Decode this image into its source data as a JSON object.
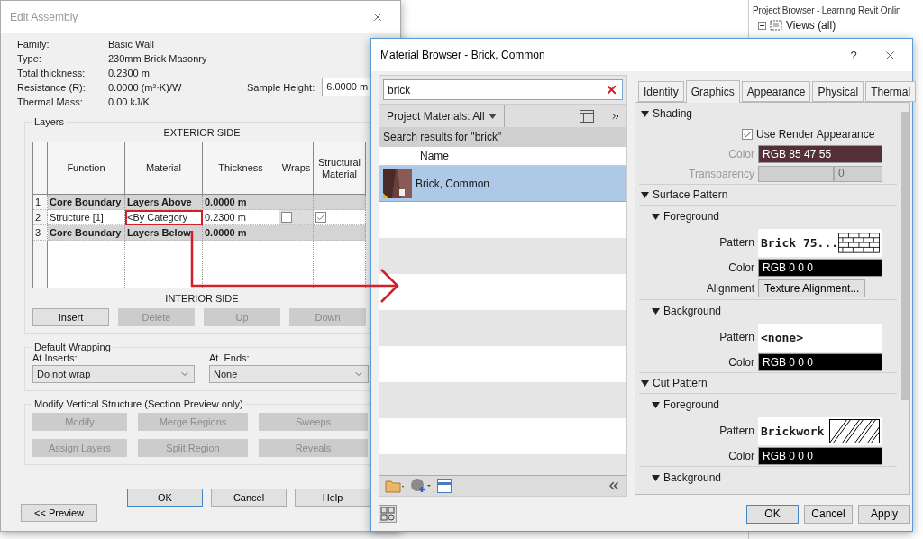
{
  "project_browser": {
    "title": "Project Browser - Learning Revit Onlin",
    "tree": [
      {
        "label": "Views (all)",
        "expanded": true
      }
    ]
  },
  "edit_assembly": {
    "title": "Edit Assembly",
    "properties": [
      {
        "label": "Family:",
        "value": "Basic Wall"
      },
      {
        "label": "Type:",
        "value": "230mm Brick Masonry"
      },
      {
        "label": "Total thickness:",
        "value": "0.2300 m"
      },
      {
        "label": "Resistance (R):",
        "value": "0.0000 (m²·K)/W"
      },
      {
        "label": "Thermal Mass:",
        "value": "0.00 kJ/K"
      }
    ],
    "sample_height": {
      "label": "Sample Height:",
      "value": "6.0000 m"
    },
    "layers": {
      "title": "Layers",
      "top_caption": "EXTERIOR SIDE",
      "bottom_caption": "INTERIOR SIDE",
      "columns": [
        "Function",
        "Material",
        "Thickness",
        "Wraps",
        "Structural Material"
      ],
      "rows": [
        {
          "index": "1",
          "kind": "boundary",
          "function": "Core Boundary",
          "material": "Layers Above",
          "thickness": "0.0000 m",
          "highlighted": false
        },
        {
          "index": "2",
          "kind": "layer",
          "function": "Structure [1]",
          "material": "<By Category",
          "thickness": "0.2300 m",
          "wraps": false,
          "structural": true,
          "highlighted": true
        },
        {
          "index": "3",
          "kind": "boundary",
          "function": "Core Boundary",
          "material": "Layers Below",
          "thickness": "0.0000 m",
          "highlighted": false
        }
      ],
      "buttons": [
        {
          "label": "Insert",
          "disabled": false
        },
        {
          "label": "Delete",
          "disabled": true
        },
        {
          "label": "Up",
          "disabled": true
        },
        {
          "label": "Down",
          "disabled": true
        }
      ]
    },
    "default_wrapping": {
      "title": "Default Wrapping",
      "fields": [
        {
          "label": "At Inserts:",
          "value": "Do not wrap"
        },
        {
          "label": "At  Ends:",
          "value": "None"
        }
      ]
    },
    "modify_structure": {
      "title": "Modify Vertical Structure (Section Preview only)",
      "buttons": [
        {
          "label": "Modify",
          "disabled": true
        },
        {
          "label": "Merge Regions",
          "disabled": true
        },
        {
          "label": "Sweeps",
          "disabled": true
        },
        {
          "label": "Assign Layers",
          "disabled": true
        },
        {
          "label": "Split Region",
          "disabled": true
        },
        {
          "label": "Reveals",
          "disabled": true
        }
      ]
    },
    "footer_buttons": [
      {
        "label": "OK",
        "default": true
      },
      {
        "label": "Cancel",
        "default": false
      },
      {
        "label": "Help",
        "default": false
      }
    ],
    "preview_button": "<< Preview"
  },
  "material_browser": {
    "title": "Material Browser - Brick, Common",
    "help": "?",
    "search": {
      "value": "brick"
    },
    "filter": "Project Materials: All",
    "results_caption": "Search results for \"brick\"",
    "list_header": "Name",
    "materials": [
      {
        "name": "Brick, Common",
        "selected": true
      }
    ],
    "tabs": [
      {
        "label": "Identity",
        "selected": false
      },
      {
        "label": "Graphics",
        "selected": true
      },
      {
        "label": "Appearance",
        "selected": false
      },
      {
        "label": "Physical",
        "selected": false
      },
      {
        "label": "Thermal",
        "selected": false
      }
    ],
    "sections": [
      {
        "title": "Shading",
        "expanded": true,
        "rows": [
          {
            "kind": "checkbox",
            "label": "Use Render Appearance",
            "checked": true
          },
          {
            "kind": "color",
            "label": "Color",
            "value": "RGB 85 47 55",
            "color": "#552f37",
            "disabled": true
          },
          {
            "kind": "transparency",
            "label": "Transparency",
            "value": "0",
            "level": 0,
            "disabled": true
          }
        ]
      },
      {
        "title": "Surface Pattern",
        "expanded": true,
        "groups": [
          {
            "title": "Foreground",
            "expanded": true,
            "rows": [
              {
                "kind": "brick_pattern",
                "label": "Pattern",
                "value": "Brick 75..."
              },
              {
                "kind": "color",
                "label": "Color",
                "value": "RGB 0 0 0",
                "color": "#000000",
                "disabled": false
              },
              {
                "kind": "button",
                "label": "Alignment",
                "value": "Texture Alignment..."
              }
            ]
          },
          {
            "title": "Background",
            "expanded": true,
            "rows": [
              {
                "kind": "pattern",
                "label": "Pattern",
                "value": "<none>"
              },
              {
                "kind": "color",
                "label": "Color",
                "value": "RGB 0 0 0",
                "color": "#000000",
                "disabled": false
              }
            ]
          }
        ]
      },
      {
        "title": "Cut Pattern",
        "expanded": true,
        "groups": [
          {
            "title": "Foreground",
            "expanded": true,
            "rows": [
              {
                "kind": "hatch_pattern",
                "label": "Pattern",
                "value": "Brickwork"
              },
              {
                "kind": "color",
                "label": "Color",
                "value": "RGB 0 0 0",
                "color": "#000000",
                "disabled": false
              }
            ]
          },
          {
            "title": "Background",
            "expanded": true
          }
        ]
      }
    ],
    "footer_buttons": [
      {
        "label": "OK",
        "default": true
      },
      {
        "label": "Cancel",
        "default": false
      },
      {
        "label": "Apply",
        "default": false
      }
    ]
  }
}
